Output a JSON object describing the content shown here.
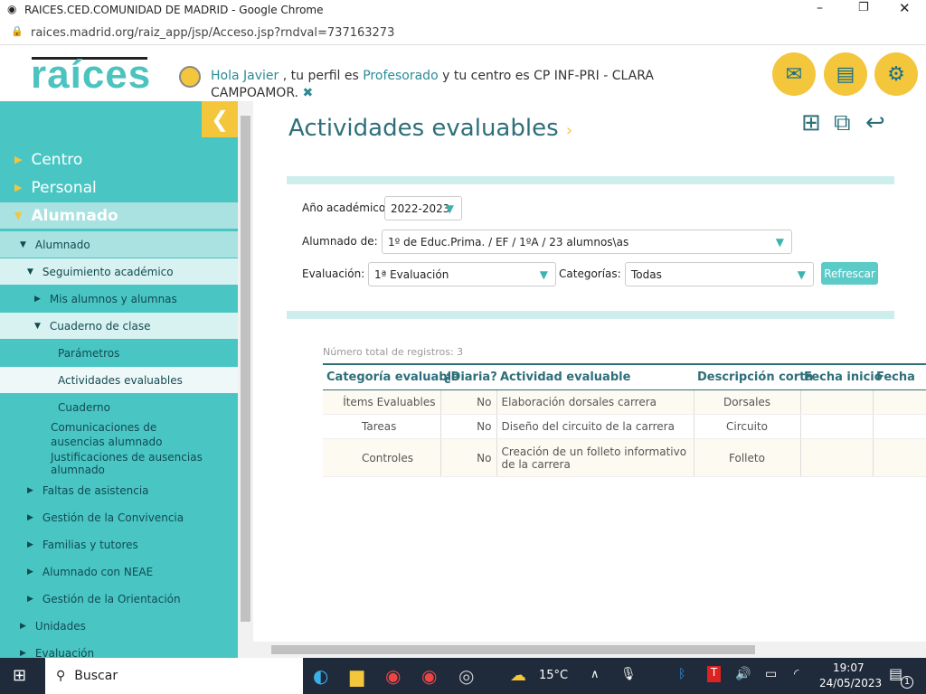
{
  "browser": {
    "title": "RAICES.CED.COMUNIDAD DE MADRID - Google Chrome",
    "url": "raices.madrid.org/raiz_app/jsp/Acceso.jsp?rndval=737163273"
  },
  "header": {
    "logo": "raíces",
    "greet_prefix": "Hola",
    "user": "Javier",
    "mid1": ", tu perfil es",
    "profile": "Profesorado",
    "mid2": "y tu centro es CP INF-PRI - CLARA CAMPOAMOR."
  },
  "sidebar": {
    "items": [
      {
        "label": "Centro"
      },
      {
        "label": "Personal"
      },
      {
        "label": "Alumnado"
      },
      {
        "label": "Alumnado"
      },
      {
        "label": "Seguimiento académico"
      },
      {
        "label": "Mis alumnos y alumnas"
      },
      {
        "label": "Cuaderno de clase"
      },
      {
        "label": "Parámetros"
      },
      {
        "label": "Actividades evaluables"
      },
      {
        "label": "Cuaderno"
      },
      {
        "label": "Comunicaciones de ausencias alumnado"
      },
      {
        "label": "Justificaciones de ausencias alumnado"
      },
      {
        "label": "Faltas de asistencia"
      },
      {
        "label": "Gestión de la Convivencia"
      },
      {
        "label": "Familias y tutores"
      },
      {
        "label": "Alumnado con NEAE"
      },
      {
        "label": "Gestión de la Orientación"
      },
      {
        "label": "Unidades"
      },
      {
        "label": "Evaluación"
      }
    ]
  },
  "page": {
    "title": "Actividades evaluables",
    "filters": {
      "year_label": "Año académico:",
      "year": "2022-2023",
      "group_label": "Alumnado de:",
      "group": "1º de Educ.Prima. / EF / 1ºA / 23 alumnos\\as",
      "eval_label": "Evaluación:",
      "eval": "1ª Evaluación",
      "cat_label": "Categorías:",
      "cat": "Todas",
      "refresh": "Refrescar",
      "required": "*"
    },
    "count": "Número total de registros: 3",
    "columns": [
      "Categoría evaluable",
      "¿Diaria?",
      "Actividad evaluable",
      "Descripción corta",
      "Fecha inicio",
      "Fecha"
    ],
    "rows": [
      [
        "Ítems Evaluables",
        "No",
        "Elaboración dorsales carrera",
        "Dorsales",
        "",
        ""
      ],
      [
        "Tareas",
        "No",
        "Diseño del circuito de la carrera",
        "Circuito",
        "",
        ""
      ],
      [
        "Controles",
        "No",
        "Creación de un folleto informativo de la carrera",
        "Folleto",
        "",
        ""
      ]
    ]
  },
  "taskbar": {
    "search": "Buscar",
    "temp": "15°C",
    "time": "19:07",
    "date": "24/05/2023",
    "notif": "1"
  }
}
